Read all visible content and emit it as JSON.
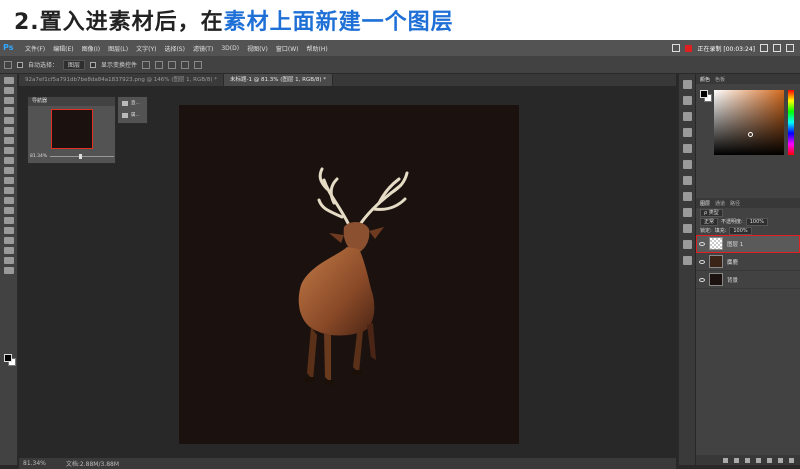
{
  "caption": {
    "prefix": "2.置入进素材后，在",
    "highlight": "素材上面新建一个图层"
  },
  "app": {
    "logo": "Ps",
    "menus": [
      "文件(F)",
      "编辑(E)",
      "图像(I)",
      "图层(L)",
      "文字(Y)",
      "选择(S)",
      "滤镜(T)",
      "3D(D)",
      "视图(V)",
      "窗口(W)",
      "帮助(H)"
    ],
    "recording": "正在录制 [00:03:24]"
  },
  "options": {
    "auto_select": "自动选择：",
    "target": "图层",
    "transform": "显示变换控件"
  },
  "tabs": [
    {
      "label": "92a7ef1cf5a791db7be8da84a1837923.png @ 146% (图层 1, RGB/8) *"
    },
    {
      "label": "未标题-1 @ 81.3% (图层 1, RGB/8) *"
    }
  ],
  "navigator": {
    "title": "导航器",
    "zoom": "81.34%",
    "items": [
      "直...",
      "属..."
    ]
  },
  "status": {
    "zoom": "81.34%",
    "doc": "文档:2.88M/3.88M"
  },
  "color_panel": {
    "tabs": [
      "颜色",
      "色板"
    ]
  },
  "layers_panel": {
    "tabs": [
      "图层",
      "通道",
      "路径"
    ],
    "kind": "ρ 类型",
    "blend": "正常",
    "opacity_label": "不透明度:",
    "opacity": "100%",
    "lock_label": "锁定:",
    "fill_label": "填充:",
    "fill": "100%",
    "layers": [
      {
        "name": "图层 1",
        "thumb": "trans",
        "selected": true
      },
      {
        "name": "麋鹿",
        "thumb": "deer",
        "selected": false
      },
      {
        "name": "背景",
        "thumb": "dark",
        "selected": false
      }
    ]
  },
  "colors": {
    "accent": "#1e6fd6",
    "highlight": "#e02020",
    "doc_bg": "#1b1210"
  }
}
